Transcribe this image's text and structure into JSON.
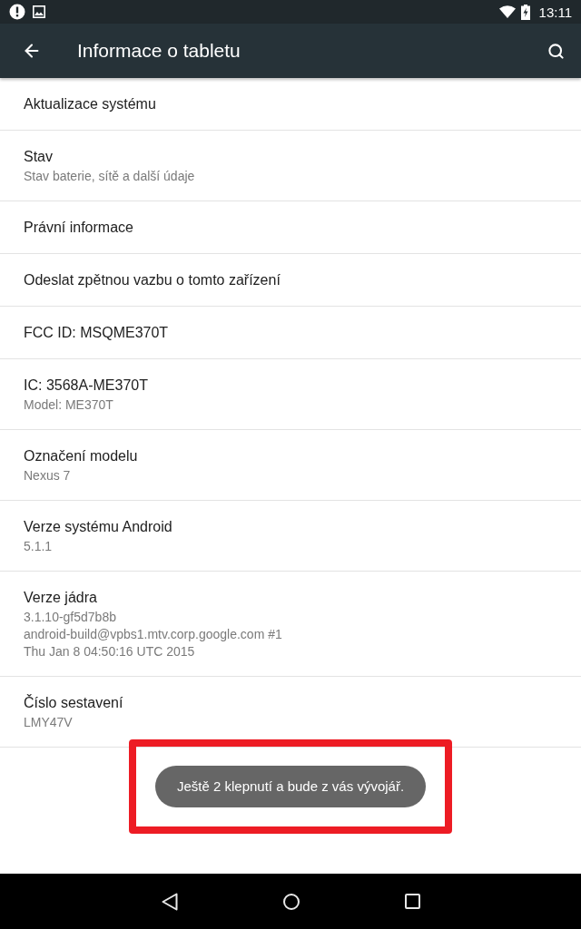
{
  "status_bar": {
    "time": "13:11"
  },
  "toolbar": {
    "title": "Informace o tabletu"
  },
  "items": [
    {
      "title": "Aktualizace systému"
    },
    {
      "title": "Stav",
      "summary": [
        "Stav baterie, sítě a další údaje"
      ]
    },
    {
      "title": "Právní informace"
    },
    {
      "title": "Odeslat zpětnou vazbu o tomto zařízení"
    },
    {
      "title": "FCC ID: MSQME370T"
    },
    {
      "title": "IC: 3568A-ME370T",
      "summary": [
        "Model: ME370T"
      ]
    },
    {
      "title": "Označení modelu",
      "summary": [
        "Nexus 7"
      ]
    },
    {
      "title": "Verze systému Android",
      "summary": [
        "5.1.1"
      ]
    },
    {
      "title": "Verze jádra",
      "summary": [
        "3.1.10-gf5d7b8b",
        "android-build@vpbs1.mtv.corp.google.com #1",
        "Thu Jan 8 04:50:16 UTC 2015"
      ]
    },
    {
      "title": "Číslo sestavení",
      "summary": [
        "LMY47V"
      ]
    }
  ],
  "toast": {
    "text": "Ještě 2 klepnutí a bude z vás vývojář.",
    "highlighted": true
  }
}
